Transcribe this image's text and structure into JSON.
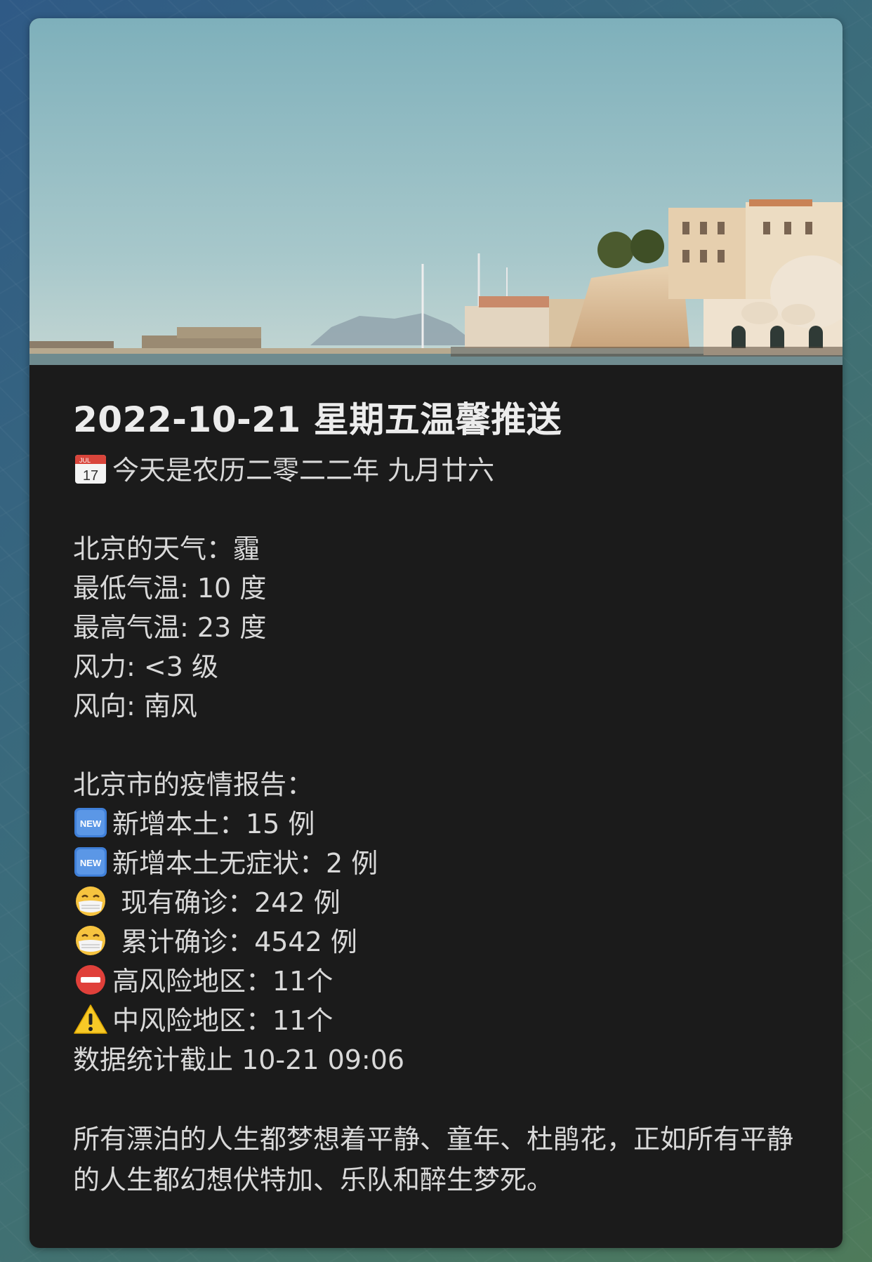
{
  "post": {
    "title": "2022-10-21  星期五温馨推送",
    "lunar": "今天是农历二零二二年 九月廿六",
    "weather": {
      "city_line": "北京的天气：霾",
      "low": "最低气温: 10 度",
      "high": "最高气温: 23 度",
      "wind_force": "风力: <3 级",
      "wind_dir": "风向: 南风"
    },
    "epidemic": {
      "heading": "北京市的疫情报告：",
      "new_local": "新增本土：15 例",
      "new_asymptomatic": "新增本土无症状：2 例",
      "current_confirmed": " 现有确诊：242 例",
      "total_confirmed": " 累计确诊：4542 例",
      "high_risk": "高风险地区：11个",
      "mid_risk": "中风险地区：11个",
      "updated": "数据统计截止 10-21 09:06"
    },
    "quote": "所有漂泊的人生都梦想着平静、童年、杜鹃花，正如所有平静的人生都幻想伏特加、乐队和醉生梦死。"
  },
  "icons": {
    "calendar": "calendar-icon",
    "new": "new-badge-icon",
    "mask": "medical-mask-face-icon",
    "no_entry": "no-entry-icon",
    "warning": "warning-icon"
  },
  "calendar_icon_text": {
    "month": "JUL",
    "day": "17"
  },
  "new_badge_text": "NEW",
  "colors": {
    "card_bg": "#1b1b1b",
    "text": "#d9d9d9",
    "sky": "#8fb8c2"
  }
}
